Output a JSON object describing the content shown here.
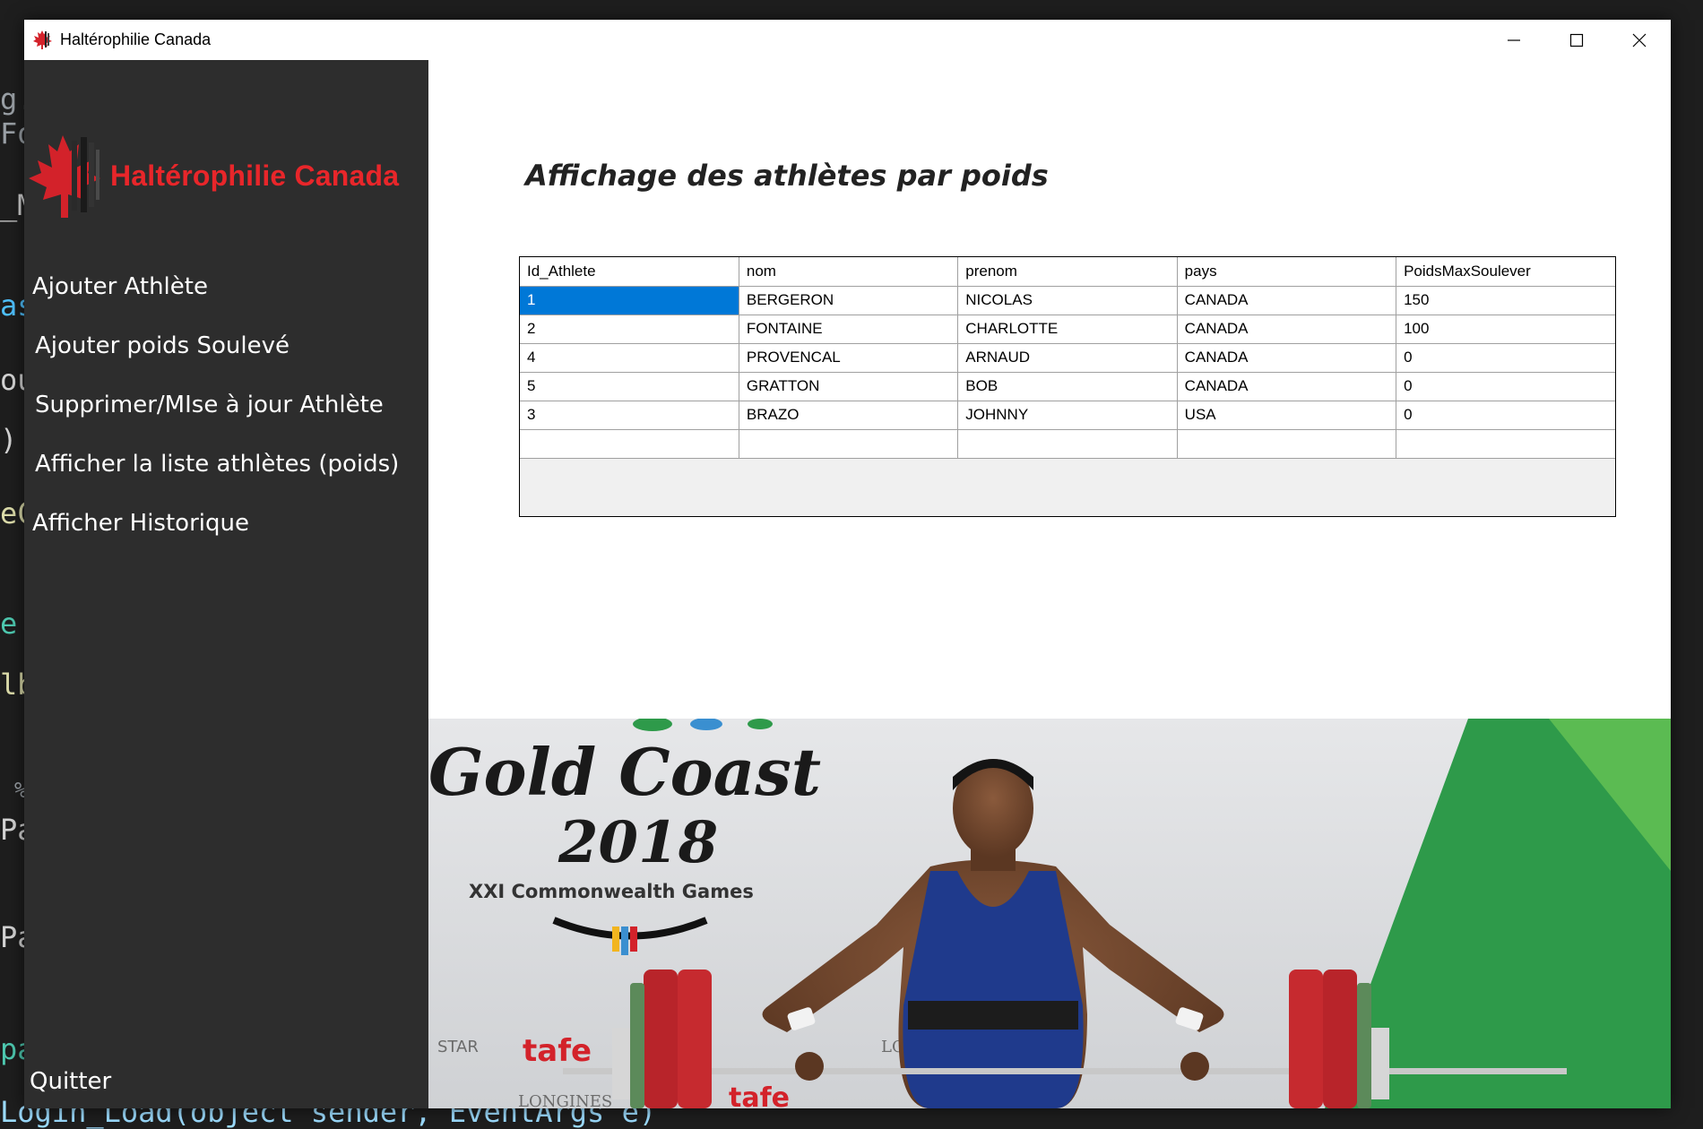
{
  "window": {
    "title": "Haltérophilie Canada",
    "controls": {
      "minimize": "minimize-icon",
      "maximize": "maximize-icon",
      "close": "close-icon"
    }
  },
  "sidebar": {
    "brand": "Haltérophilie Canada",
    "items": [
      {
        "label": "Ajouter Athlète"
      },
      {
        "label": "Ajouter poids Soulevé"
      },
      {
        "label": "Supprimer/MIse à jour Athlète"
      },
      {
        "label": "Afficher la liste athlètes (poids)"
      },
      {
        "label": "Afficher Historique"
      }
    ],
    "quit": "Quitter"
  },
  "main": {
    "title": "Affichage des athlètes par poids",
    "table": {
      "columns": [
        "Id_Athlete",
        "nom",
        "prenom",
        "pays",
        "PoidsMaxSoulever"
      ],
      "rows": [
        [
          "1",
          "BERGERON",
          "NICOLAS",
          "CANADA",
          "150"
        ],
        [
          "2",
          "FONTAINE",
          "CHARLOTTE",
          "CANADA",
          "100"
        ],
        [
          "4",
          "PROVENCAL",
          "ARNAUD",
          "CANADA",
          "0"
        ],
        [
          "5",
          "GRATTON",
          "BOB",
          "CANADA",
          "0"
        ],
        [
          "3",
          "BRAZO",
          "JOHNNY",
          "USA",
          "0"
        ]
      ]
    }
  },
  "photo": {
    "event_line1": "Gold Coast",
    "event_line2": "2018",
    "event_line3": "XXI Commonwealth Games",
    "sponsor_a": "tafe",
    "sponsor_b": "LONGINES",
    "sponsor_c": "STAR"
  },
  "code_background": {
    "fragments": [
      "g.",
      "Fo",
      "_M",
      "as",
      "ou",
      ")",
      "eC",
      "e",
      "lb",
      "%",
      "Pa",
      "Pa",
      "pa",
      "Login_Load(object sender, EventArgs e)"
    ]
  },
  "colors": {
    "sidebar_bg": "#2d2d2d",
    "brand_red": "#e8262a",
    "selection_blue": "#0078d7"
  }
}
